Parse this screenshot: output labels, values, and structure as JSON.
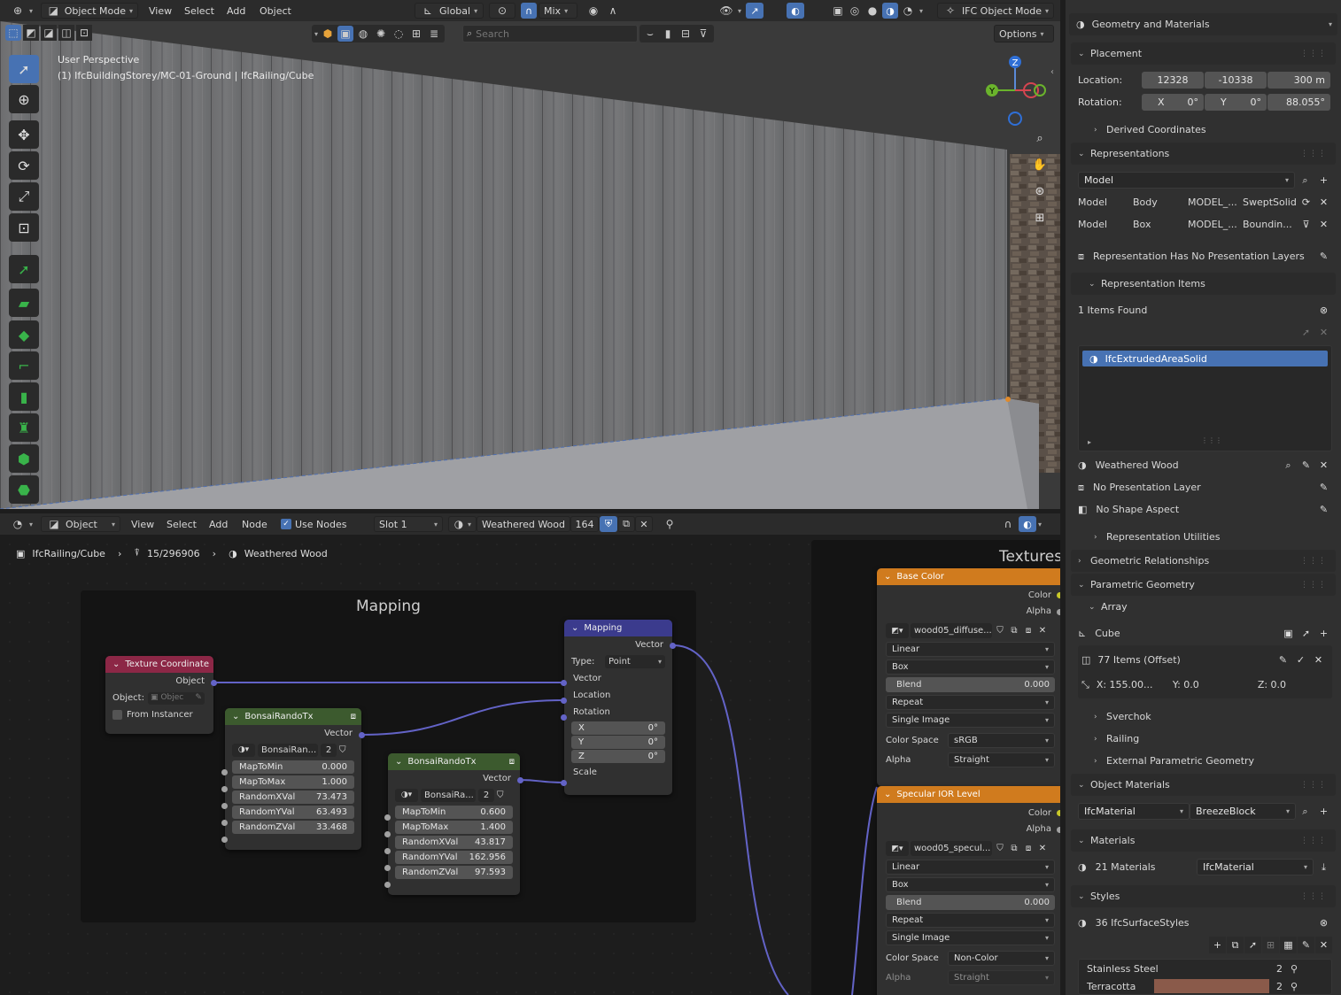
{
  "viewport_header": {
    "mode": "Object Mode",
    "menu": [
      "View",
      "Select",
      "Add",
      "Object"
    ],
    "transform": "Global",
    "pivot": "Mix",
    "ifc_mode": "IFC Object Mode",
    "search_placeholder": "Search",
    "options": "Options"
  },
  "viewport": {
    "perspective": "User Perspective",
    "context": "(1) IfcBuildingStorey/MC-01-Ground | IfcRailing/Cube",
    "gizmo": {
      "y": "Y",
      "z": "Z"
    }
  },
  "node_header": {
    "editor": "Object",
    "menu": [
      "View",
      "Select",
      "Add",
      "Node"
    ],
    "use_nodes": "Use Nodes",
    "slot": "Slot 1",
    "material": "Weathered Wood",
    "users": "164"
  },
  "breadcrumb": {
    "object": "IfcRailing/Cube",
    "mesh": "15/296906",
    "material": "Weathered Wood"
  },
  "frames": {
    "mapping": "Mapping",
    "textures": "Textures"
  },
  "nodes": {
    "texcoord": {
      "title": "Texture Coordinate",
      "output": "Object",
      "object_label": "Object:",
      "object_placeholder": "Objec",
      "from_instancer": "From Instancer"
    },
    "rando1": {
      "title": "BonsaiRandoTx",
      "output": "Vector",
      "group": "BonsaiRan...",
      "users": "2",
      "fields": [
        {
          "k": "MapToMin",
          "v": "0.000"
        },
        {
          "k": "MapToMax",
          "v": "1.000"
        },
        {
          "k": "RandomXVal",
          "v": "73.473"
        },
        {
          "k": "RandomYVal",
          "v": "63.493"
        },
        {
          "k": "RandomZVal",
          "v": "33.468"
        }
      ]
    },
    "rando2": {
      "title": "BonsaiRandoTx",
      "output": "Vector",
      "group": "BonsaiRa...",
      "users": "2",
      "fields": [
        {
          "k": "MapToMin",
          "v": "0.600"
        },
        {
          "k": "MapToMax",
          "v": "1.400"
        },
        {
          "k": "RandomXVal",
          "v": "43.817"
        },
        {
          "k": "RandomYVal",
          "v": "162.956"
        },
        {
          "k": "RandomZVal",
          "v": "97.593"
        }
      ]
    },
    "mapping": {
      "title": "Mapping",
      "output": "Vector",
      "type_label": "Type:",
      "type": "Point",
      "inputs": [
        "Vector",
        "Location",
        "Rotation"
      ],
      "rot": [
        {
          "k": "X",
          "v": "0°"
        },
        {
          "k": "Y",
          "v": "0°"
        },
        {
          "k": "Z",
          "v": "0°"
        }
      ],
      "scale": "Scale"
    },
    "basecolor": {
      "title": "Base Color",
      "out1": "Color",
      "out2": "Alpha",
      "image": "wood05_diffuse...",
      "interp": "Linear",
      "proj": "Box",
      "blend_label": "Blend",
      "blend": "0.000",
      "ext": "Repeat",
      "src": "Single Image",
      "cs_label": "Color Space",
      "cs": "sRGB",
      "alpha_label": "Alpha",
      "alpha": "Straight"
    },
    "specular": {
      "title": "Specular IOR Level",
      "out1": "Color",
      "out2": "Alpha",
      "image": "wood05_specul...",
      "interp": "Linear",
      "proj": "Box",
      "blend_label": "Blend",
      "blend": "0.000",
      "ext": "Repeat",
      "src": "Single Image",
      "cs_label": "Color Space",
      "cs": "Non-Color",
      "alpha_label": "Alpha",
      "alpha": "Straight"
    }
  },
  "props": {
    "panel": "Geometry and Materials",
    "placement": "Placement",
    "location_label": "Location:",
    "loc": [
      "12328",
      "-10338",
      "300 m"
    ],
    "rotation_label": "Rotation:",
    "rot": [
      {
        "k": "X",
        "v": "0°"
      },
      {
        "k": "Y",
        "v": "0°"
      },
      {
        "k": "",
        "v": "88.055°"
      }
    ],
    "derived": "Derived Coordinates",
    "representations": "Representations",
    "rep_context": "Model",
    "reps": [
      {
        "a": "Model",
        "b": "Body",
        "c": "MODEL_...",
        "d": "SweptSolid"
      },
      {
        "a": "Model",
        "b": "Box",
        "c": "MODEL_...",
        "d": "Boundin..."
      }
    ],
    "no_layers": "Representation Has No Presentation Layers",
    "rep_items": "Representation Items",
    "items_found": "1 Items Found",
    "item": "IfcExtrudedAreaSolid",
    "style": "Weathered Wood",
    "no_pres": "No Presentation Layer",
    "no_shape": "No Shape Aspect",
    "rep_utils": "Representation Utilities",
    "geo_rel": "Geometric Relationships",
    "param": "Parametric Geometry",
    "array": "Array",
    "cube": "Cube",
    "items_offset": "77 Items (Offset)",
    "offset": [
      "X: 155.00...",
      "Y: 0.0",
      "Z: 0.0"
    ],
    "sverchok": "Sverchok",
    "railing": "Railing",
    "ext_param": "External Parametric Geometry",
    "obj_mat": "Object Materials",
    "mat_type": "IfcMaterial",
    "mat_name": "BreezeBlock",
    "materials": "Materials",
    "mat_count": "21 Materials",
    "mat_filter": "IfcMaterial",
    "styles": "Styles",
    "styles_count": "36 IfcSurfaceStyles",
    "style_list": [
      {
        "n": "Stainless Steel",
        "c": "2"
      },
      {
        "n": "Terracotta",
        "c": "2"
      }
    ]
  },
  "colors": {
    "accent": "#4772b3",
    "texcoord": "#8c2746",
    "group": "#3c5a2e",
    "mapping": "#3b3b8d",
    "texture": "#d07b1e",
    "link": "#6363c7"
  }
}
